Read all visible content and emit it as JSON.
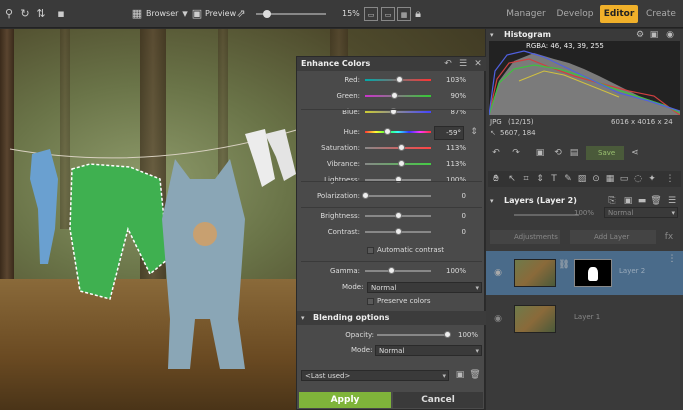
{
  "toolbar": {
    "browser_label": "Browser",
    "preview_label": "Preview",
    "zoom_value": "15%",
    "zoom_fraction": 0.15,
    "modes": [
      "Manager",
      "Develop",
      "Editor",
      "Create"
    ],
    "active_mode": "Editor"
  },
  "dialog": {
    "title": "Enhance Colors",
    "sliders": [
      {
        "label": "Red:",
        "value": "103%",
        "pos": 0.52
      },
      {
        "label": "Green:",
        "value": "90%",
        "pos": 0.45
      },
      {
        "label": "Blue:",
        "value": "87%",
        "pos": 0.43
      },
      {
        "label": "Hue:",
        "value": "-59°",
        "pos": 0.34
      },
      {
        "label": "Saturation:",
        "value": "113%",
        "pos": 0.56
      },
      {
        "label": "Vibrance:",
        "value": "113%",
        "pos": 0.56
      },
      {
        "label": "Lightness:",
        "value": "100%",
        "pos": 0.5
      },
      {
        "label": "Polarization:",
        "value": "0",
        "pos": 0.0
      },
      {
        "label": "Brightness:",
        "value": "0",
        "pos": 0.5
      },
      {
        "label": "Contrast:",
        "value": "0",
        "pos": 0.5
      }
    ],
    "auto_contrast_label": "Automatic contrast",
    "gamma": {
      "label": "Gamma:",
      "value": "100%",
      "pos": 0.4
    },
    "mode_label": "Mode:",
    "mode_value": "Normal",
    "preserve_colors_label": "Preserve colors",
    "blending": {
      "title": "Blending options",
      "opacity_label": "Opacity:",
      "opacity_value": "100%",
      "opacity_pos": 1.0,
      "mode_label": "Mode:",
      "mode_value": "Normal"
    },
    "preset_value": "<Last used>",
    "apply_label": "Apply",
    "cancel_label": "Cancel"
  },
  "right_panel": {
    "histogram_title": "Histogram",
    "rgba_readout": "RGBA: 46, 43, 39, 255",
    "file_type": "JPG",
    "file_index": "(12/15)",
    "dimensions": "6016 x 4016 x 24",
    "coords": "5607, 184",
    "save_label": "Save",
    "layers_title": "Layers (Layer 2)",
    "opacity_value": "100%",
    "blend_mode": "Normal",
    "adjustments_label": "Adjustments",
    "add_layer_label": "Add Layer",
    "layers": [
      {
        "name": "Layer 2",
        "selected": true
      },
      {
        "name": "Layer 1",
        "selected": false
      }
    ]
  },
  "colors": {
    "accent": "#f0b02a",
    "apply": "#7fb43a",
    "selection": "#4a6b8a"
  }
}
